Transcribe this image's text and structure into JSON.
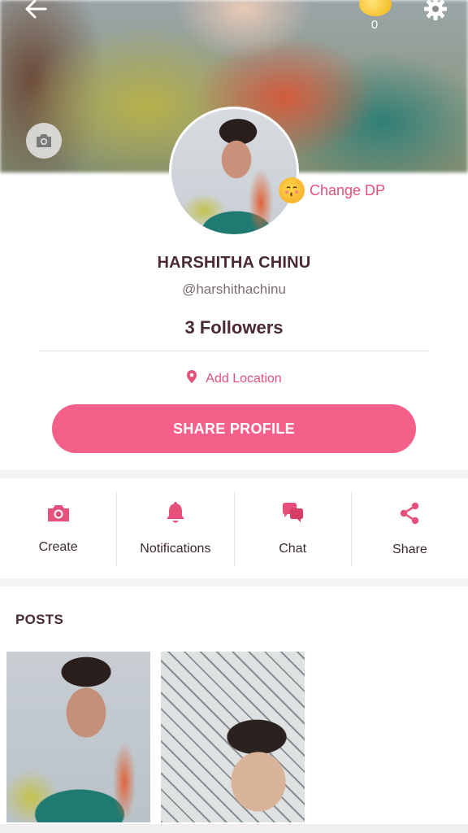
{
  "header": {
    "coin_count": "0"
  },
  "profile": {
    "change_dp_label": "Change DP",
    "name": "HARSHITHA CHINU",
    "handle": "@harshithachinu",
    "followers": "3 Followers",
    "location_label": "Add Location",
    "share_button": "SHARE PROFILE"
  },
  "actions": [
    {
      "label": "Create",
      "icon": "camera-icon"
    },
    {
      "label": "Notifications",
      "icon": "bell-icon"
    },
    {
      "label": "Chat",
      "icon": "chat-icon"
    },
    {
      "label": "Share",
      "icon": "share-icon"
    }
  ],
  "posts": {
    "title": "POSTS"
  },
  "colors": {
    "accent": "#f5608a",
    "accent_text": "#e6507a",
    "title_text": "#4a2a36"
  }
}
